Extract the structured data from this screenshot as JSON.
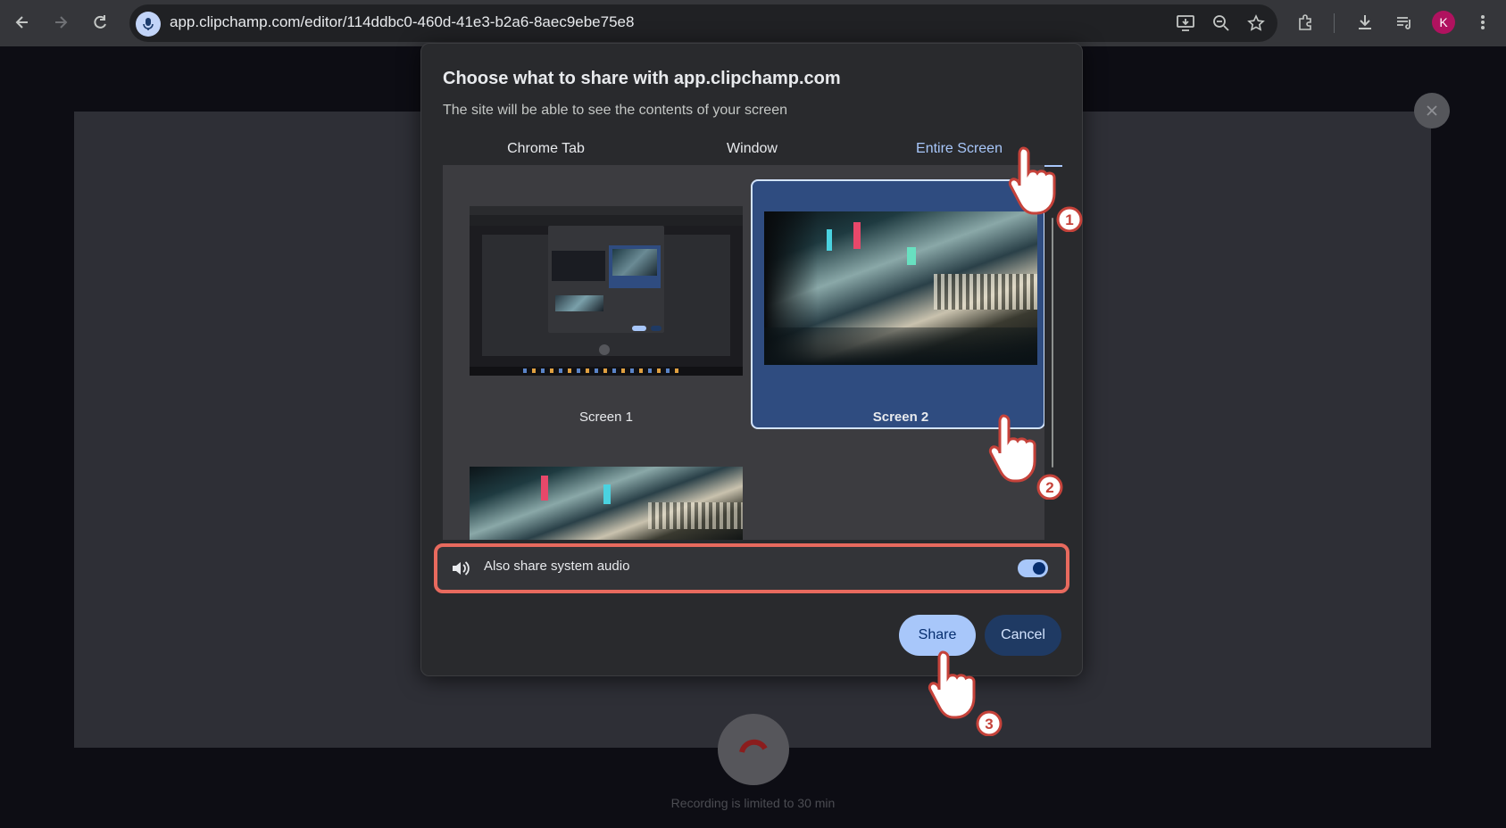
{
  "browser": {
    "url": "app.clipchamp.com/editor/114ddbc0-460d-41e3-b2a6-8aec9ebe75e8",
    "avatar_letter": "K",
    "icons": [
      "back-icon",
      "forward-icon",
      "reload-icon",
      "mic-icon",
      "install-app-icon",
      "zoom-icon",
      "bookmark-star-icon",
      "extensions-icon",
      "download-icon",
      "media-controls-icon",
      "menu-icon"
    ]
  },
  "dialog": {
    "title": "Choose what to share with app.clipchamp.com",
    "subtitle": "The site will be able to see the contents of your screen",
    "tabs": [
      {
        "label": "Chrome Tab",
        "active": false
      },
      {
        "label": "Window",
        "active": false
      },
      {
        "label": "Entire Screen",
        "active": true
      }
    ],
    "screens": [
      {
        "label": "Screen 1",
        "selected": false
      },
      {
        "label": "Screen 2",
        "selected": true
      }
    ],
    "audio_label": "Also share system audio",
    "audio_enabled": true,
    "share_label": "Share",
    "cancel_label": "Cancel"
  },
  "steps": [
    "1",
    "2",
    "3"
  ],
  "app": {
    "limit_text": "Recording is limited to 30 min"
  },
  "colors": {
    "accent": "#a8c7fa",
    "highlight": "#e86a5e",
    "selected_card": "#2f4c80"
  }
}
